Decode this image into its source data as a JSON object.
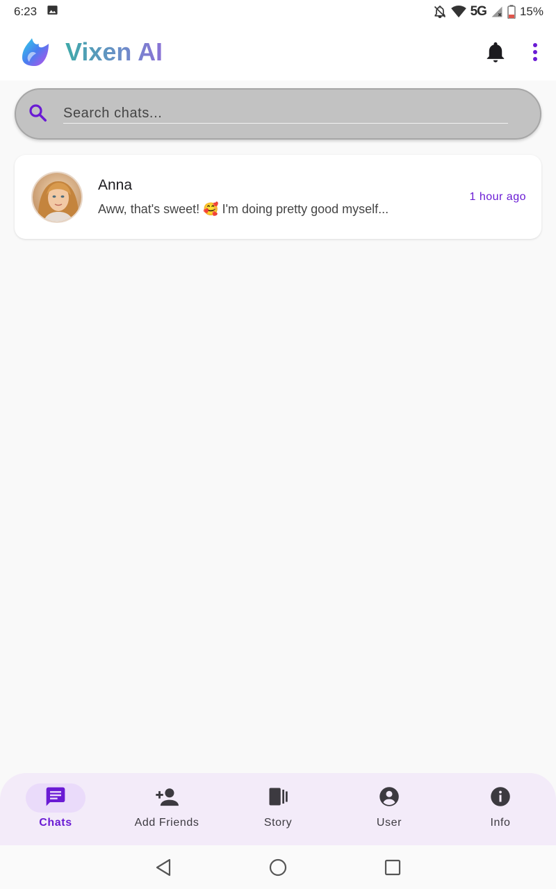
{
  "status_bar": {
    "time": "6:23",
    "network": "5G",
    "battery": "15%",
    "icons": [
      "image-icon",
      "notifications-off-icon",
      "wifi-icon",
      "signal-icon",
      "battery-icon"
    ]
  },
  "app_bar": {
    "title": "Vixen AI",
    "icons": [
      "app-logo",
      "bell-icon",
      "more-vert-icon"
    ]
  },
  "search": {
    "placeholder": "Search chats..."
  },
  "chats": [
    {
      "name": "Anna",
      "preview_prefix": "Aww, that's sweet! ",
      "preview_emoji": "🥰",
      "preview_suffix": " I'm doing pretty good myself...",
      "time": "1 hour ago"
    }
  ],
  "bottom_nav": {
    "items": [
      {
        "label": "Chats",
        "icon": "chat-icon",
        "active": true
      },
      {
        "label": "Add Friends",
        "icon": "person-add-icon",
        "active": false
      },
      {
        "label": "Story",
        "icon": "story-icon",
        "active": false
      },
      {
        "label": "User",
        "icon": "account-circle-icon",
        "active": false
      },
      {
        "label": "Info",
        "icon": "info-icon",
        "active": false
      }
    ]
  },
  "system_nav": {
    "icons": [
      "back-icon",
      "home-icon",
      "recents-icon"
    ]
  },
  "colors": {
    "accent": "#6a1bd4",
    "nav_background": "#f3ebf9",
    "search_background": "#c2c2c2"
  }
}
